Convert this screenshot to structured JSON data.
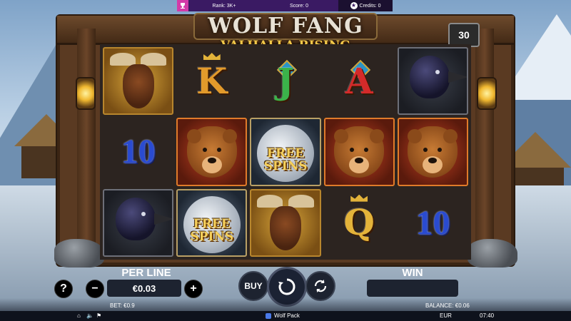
{
  "top_bar": {
    "rank": "Rank: 3K+",
    "score": "Score: 0",
    "credits": "Credits: 0",
    "trophy_icon": "trophy-icon",
    "credits_icon": "star-badge-icon"
  },
  "game": {
    "title_main": "WOLF FANG",
    "title_sub": "VALHALLA RISING",
    "counter": "30"
  },
  "reels": [
    [
      {
        "symbol": "moose",
        "bg": "gold"
      },
      {
        "symbol": "K",
        "bg": "none",
        "color": "#e29a2b",
        "crown": true
      },
      {
        "symbol": "J",
        "bg": "none",
        "color": "#3bb24a",
        "emblem": true
      },
      {
        "symbol": "A",
        "bg": "none",
        "color": "#d42a2a",
        "emblem": true
      },
      {
        "symbol": "raven",
        "bg": "dark"
      }
    ],
    [
      {
        "symbol": "10",
        "bg": "none"
      },
      {
        "symbol": "bear",
        "bg": "red"
      },
      {
        "symbol": "free-spins",
        "bg": "moon",
        "text_line1": "FREE",
        "text_line2": "SPINS"
      },
      {
        "symbol": "bear",
        "bg": "red"
      },
      {
        "symbol": "bear",
        "bg": "red"
      }
    ],
    [
      {
        "symbol": "raven",
        "bg": "dark"
      },
      {
        "symbol": "free-spins",
        "bg": "moon",
        "text_line1": "FREE",
        "text_line2": "SPINS"
      },
      {
        "symbol": "moose",
        "bg": "gold"
      },
      {
        "symbol": "Q",
        "bg": "none",
        "color": "#e3b33a",
        "crown": true
      },
      {
        "symbol": "10",
        "bg": "none"
      }
    ]
  ],
  "controls": {
    "help_label": "?",
    "per_line_label": "PER LINE",
    "per_line_value": "€0.03",
    "minus_label": "−",
    "plus_label": "+",
    "buy_label": "BUY",
    "spin_icon": "spin-arrows-icon",
    "autoplay_icon": "autoplay-arrows-icon",
    "win_label": "WIN",
    "win_value": ""
  },
  "status": {
    "bet": "BET: €0.9",
    "balance": "BALANCE: €0.06"
  },
  "footer": {
    "home_icon": "home-icon",
    "sound_icon": "speaker-icon",
    "speed_icon": "rabbit-icon",
    "brand": "Wolf Pack",
    "currency": "EUR",
    "time": "07:40"
  }
}
